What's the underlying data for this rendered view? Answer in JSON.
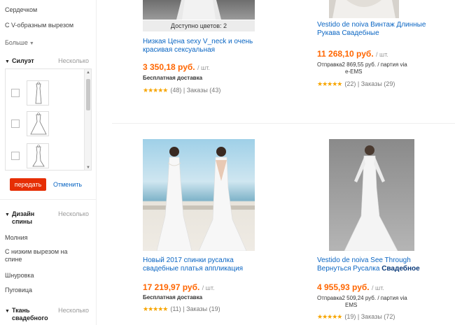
{
  "sidebar": {
    "neckline_items": [
      "Сердечком",
      "С V-образным вырезом"
    ],
    "more_label": "Больше",
    "silhouette": {
      "title": "Силуэт",
      "multi_label": "Несколько"
    },
    "submit_label": "передать",
    "cancel_label": "Отменить",
    "back_design": {
      "title_line1": "Дизайн",
      "title_line2": "спины",
      "multi_label": "Несколько",
      "items": [
        "Молния",
        "С низким вырезом на спине",
        "Шнуровка",
        "Пуговица"
      ]
    },
    "fabric": {
      "title_line1": "Ткань",
      "title_line2": "свадебного",
      "multi_label": "Несколько"
    }
  },
  "products": [
    {
      "availability": "Доступно цветов: 2",
      "title": "Низкая Цена sexy V_neck и очень красивая сексуальная",
      "price": "3 350,18 руб.",
      "unit": "/ шт.",
      "shipping": "Бесплатная доставка",
      "rating_count": "(48)",
      "orders": "Заказы (43)"
    },
    {
      "title": "Vestido de noiva Винтаж Длинные Рукава Свадебные",
      "price": "11 268,10 руб.",
      "unit": "/ шт.",
      "shipping_line1": "Отправка2 869,55 руб. / партия via",
      "shipping_line2": "e-EMS",
      "rating_count": "(22)",
      "orders": "Заказы (29)"
    },
    {
      "title": "Новый 2017 спинки русалка свадебные платья аппликация",
      "price": "17 219,97 руб.",
      "unit": "/ шт.",
      "shipping": "Бесплатная доставка",
      "rating_count": "(11)",
      "orders": "Заказы (19)"
    },
    {
      "title_start": "Vestido de noiva See Through Вернуться Русалка ",
      "title_bold": "Свадебное",
      "price": "4 955,93 руб.",
      "unit": "/ шт.",
      "shipping_line1": "Отправка2 509,24 руб. / партия via",
      "shipping_line2": "EMS",
      "rating_count": "(19)",
      "orders": "Заказы (72)"
    }
  ],
  "stars": "★★★★★",
  "separator": "|",
  "colors": {
    "price": "#ff6600",
    "link": "#0b66c3",
    "submit": "#e62e04",
    "stars": "#f7a500"
  }
}
